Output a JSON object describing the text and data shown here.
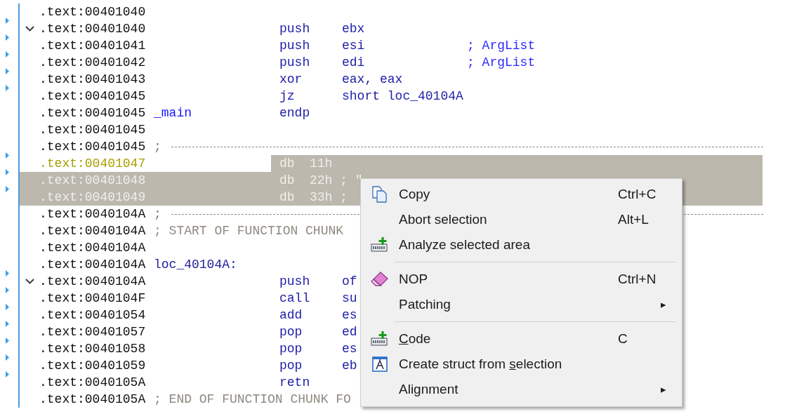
{
  "rows": [
    {
      "kind": "blank",
      "address": ".text:00401040",
      "flow_arrow": false,
      "selected": false,
      "cursor": false
    },
    {
      "kind": "code",
      "address": ".text:00401040",
      "flow_arrow": true,
      "selected": false,
      "cursor": false,
      "fold": {
        "expanded": true
      },
      "mnemonic": "push",
      "operand": "ebx"
    },
    {
      "kind": "code",
      "address": ".text:00401041",
      "flow_arrow": true,
      "selected": false,
      "cursor": false,
      "mnemonic": "push",
      "operand": "esi",
      "comment": "; ArgList"
    },
    {
      "kind": "code",
      "address": ".text:00401042",
      "flow_arrow": true,
      "selected": false,
      "cursor": false,
      "mnemonic": "push",
      "operand": "edi",
      "comment": "; ArgList"
    },
    {
      "kind": "code",
      "address": ".text:00401043",
      "flow_arrow": true,
      "selected": false,
      "cursor": false,
      "mnemonic": "xor",
      "operand": "eax, eax"
    },
    {
      "kind": "code",
      "address": ".text:00401045",
      "flow_arrow": true,
      "selected": false,
      "cursor": false,
      "mnemonic": "jz",
      "operand": "short loc_40104A"
    },
    {
      "kind": "function_end",
      "address": ".text:00401045",
      "flow_arrow": false,
      "selected": false,
      "cursor": false,
      "label": "_main",
      "mnemonic": "endp"
    },
    {
      "kind": "blank",
      "address": ".text:00401045",
      "flow_arrow": false,
      "selected": false,
      "cursor": false
    },
    {
      "kind": "divider",
      "address": ".text:00401045",
      "flow_arrow": false,
      "selected": false,
      "cursor": false,
      "label": ";"
    },
    {
      "kind": "data",
      "address": ".text:00401047",
      "flow_arrow": true,
      "selected": true,
      "cursor": true,
      "mnemonic": "db",
      "operand": "11h"
    },
    {
      "kind": "data",
      "address": ".text:00401048",
      "flow_arrow": true,
      "selected": true,
      "cursor": false,
      "mnemonic": "db",
      "operand": "22h ; \""
    },
    {
      "kind": "data",
      "address": ".text:00401049",
      "flow_arrow": true,
      "selected": true,
      "cursor": false,
      "mnemonic": "db",
      "operand": "33h ;"
    },
    {
      "kind": "divider",
      "address": ".text:0040104A",
      "flow_arrow": false,
      "selected": false,
      "cursor": false,
      "label": ";"
    },
    {
      "kind": "chunk_comment",
      "address": ".text:0040104A",
      "flow_arrow": false,
      "selected": false,
      "cursor": false,
      "label": "; START OF FUNCTION CHUNK"
    },
    {
      "kind": "blank",
      "address": ".text:0040104A",
      "flow_arrow": false,
      "selected": false,
      "cursor": false
    },
    {
      "kind": "label",
      "address": ".text:0040104A",
      "flow_arrow": false,
      "selected": false,
      "cursor": false,
      "label": "loc_40104A:"
    },
    {
      "kind": "code",
      "address": ".text:0040104A",
      "flow_arrow": true,
      "selected": false,
      "cursor": false,
      "fold": {
        "expanded": true
      },
      "mnemonic": "push",
      "operand": "of"
    },
    {
      "kind": "code",
      "address": ".text:0040104F",
      "flow_arrow": true,
      "selected": false,
      "cursor": false,
      "mnemonic": "call",
      "operand": "su"
    },
    {
      "kind": "code",
      "address": ".text:00401054",
      "flow_arrow": true,
      "selected": false,
      "cursor": false,
      "mnemonic": "add",
      "operand": "es"
    },
    {
      "kind": "code",
      "address": ".text:00401057",
      "flow_arrow": true,
      "selected": false,
      "cursor": false,
      "mnemonic": "pop",
      "operand": "ed"
    },
    {
      "kind": "code",
      "address": ".text:00401058",
      "flow_arrow": true,
      "selected": false,
      "cursor": false,
      "mnemonic": "pop",
      "operand": "es"
    },
    {
      "kind": "code",
      "address": ".text:00401059",
      "flow_arrow": true,
      "selected": false,
      "cursor": false,
      "mnemonic": "pop",
      "operand": "eb"
    },
    {
      "kind": "code",
      "address": ".text:0040105A",
      "flow_arrow": true,
      "selected": false,
      "cursor": false,
      "mnemonic": "retn"
    },
    {
      "kind": "chunk_comment",
      "address": ".text:0040105A",
      "flow_arrow": false,
      "selected": false,
      "cursor": false,
      "label": "; END OF FUNCTION CHUNK FO"
    }
  ],
  "context_menu": {
    "items": [
      {
        "kind": "copy",
        "label": "Copy",
        "shortcut": "Ctrl+C"
      },
      {
        "kind": "plain",
        "label": "Abort selection",
        "shortcut": "Alt+L"
      },
      {
        "kind": "code",
        "label": "Analyze selected area"
      },
      {
        "kind": "separator"
      },
      {
        "kind": "eraser",
        "label": "NOP",
        "shortcut": "Ctrl+N"
      },
      {
        "kind": "plain",
        "label": "Patching",
        "arrow": "▸"
      },
      {
        "kind": "separator"
      },
      {
        "kind": "code",
        "accel": "C",
        "label_after": "ode",
        "shortcut": "C"
      },
      {
        "kind": "struct",
        "label_before": "Create struct from ",
        "accel": "s",
        "label_after": "election"
      },
      {
        "kind": "plain",
        "label": "Alignment",
        "arrow": "▸"
      }
    ]
  }
}
